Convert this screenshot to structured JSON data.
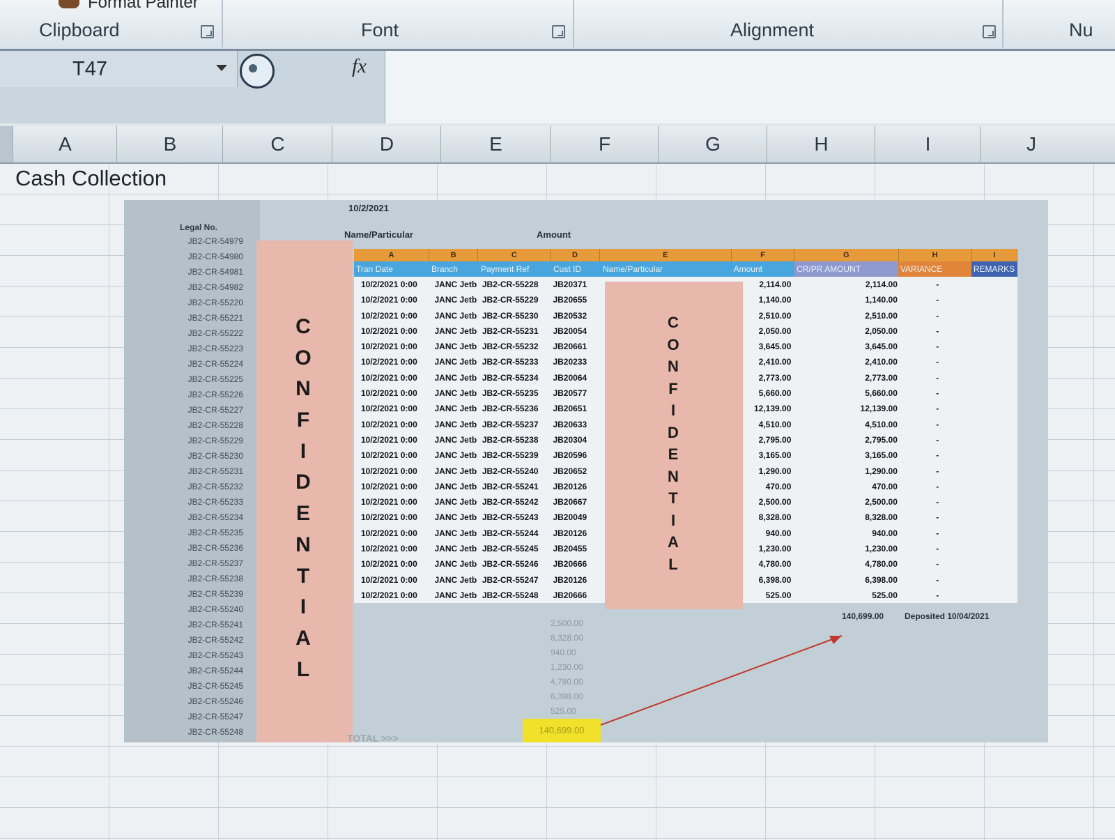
{
  "ribbon": {
    "format_painter": "Format Painter",
    "groups": [
      "Clipboard",
      "Font",
      "Alignment",
      "Nu"
    ]
  },
  "formula_bar": {
    "name_box": "T47",
    "fx_label": "fx",
    "content": ""
  },
  "columns": [
    "A",
    "B",
    "C",
    "D",
    "E",
    "F",
    "G",
    "H",
    "I",
    "J"
  ],
  "sheet": {
    "a1_text": "Cash Collection"
  },
  "pasted_image": {
    "date": "10/2/2021",
    "side_header": "Legal No.",
    "under_headers": {
      "name": "Name/Particular",
      "amount": "Amount"
    },
    "side_items": [
      "JB2-CR-54979",
      "JB2-CR-54980",
      "JB2-CR-54981",
      "JB2-CR-54982",
      "JB2-CR-55220",
      "JB2-CR-55221",
      "JB2-CR-55222",
      "JB2-CR-55223",
      "JB2-CR-55224",
      "JB2-CR-55225",
      "JB2-CR-55226",
      "JB2-CR-55227",
      "JB2-CR-55228",
      "JB2-CR-55229",
      "JB2-CR-55230",
      "JB2-CR-55231",
      "JB2-CR-55232",
      "JB2-CR-55233",
      "JB2-CR-55234",
      "JB2-CR-55235",
      "JB2-CR-55236",
      "JB2-CR-55237",
      "JB2-CR-55238",
      "JB2-CR-55239",
      "JB2-CR-55240",
      "JB2-CR-55241",
      "JB2-CR-55242",
      "JB2-CR-55243",
      "JB2-CR-55244",
      "JB2-CR-55245",
      "JB2-CR-55246",
      "JB2-CR-55247",
      "JB2-CR-55248"
    ],
    "confidential_letters": [
      "C",
      "O",
      "N",
      "F",
      "I",
      "D",
      "E",
      "N",
      "T",
      "I",
      "A",
      "L"
    ],
    "inner_column_letters": [
      "A",
      "B",
      "C",
      "D",
      "E",
      "F",
      "G",
      "H",
      "I"
    ],
    "inner_headers": [
      "Tran Date",
      "Branch",
      "Payment Ref",
      "Cust ID",
      "Name/Particular",
      "Amount",
      "CR/PR AMOUNT",
      "VARIANCE",
      "REMARKS"
    ],
    "rows": [
      {
        "date": "10/2/2021 0:00",
        "branch": "JANC Jetb",
        "ref": "JB2-CR-55228",
        "cust": "JB20371",
        "amount": "2,114.00",
        "cr": "2,114.00",
        "var": "-"
      },
      {
        "date": "10/2/2021 0:00",
        "branch": "JANC Jetb",
        "ref": "JB2-CR-55229",
        "cust": "JB20655",
        "amount": "1,140.00",
        "cr": "1,140.00",
        "var": "-"
      },
      {
        "date": "10/2/2021 0:00",
        "branch": "JANC Jetb",
        "ref": "JB2-CR-55230",
        "cust": "JB20532",
        "amount": "2,510.00",
        "cr": "2,510.00",
        "var": "-"
      },
      {
        "date": "10/2/2021 0:00",
        "branch": "JANC Jetb",
        "ref": "JB2-CR-55231",
        "cust": "JB20054",
        "amount": "2,050.00",
        "cr": "2,050.00",
        "var": "-"
      },
      {
        "date": "10/2/2021 0:00",
        "branch": "JANC Jetb",
        "ref": "JB2-CR-55232",
        "cust": "JB20661",
        "amount": "3,645.00",
        "cr": "3,645.00",
        "var": "-"
      },
      {
        "date": "10/2/2021 0:00",
        "branch": "JANC Jetb",
        "ref": "JB2-CR-55233",
        "cust": "JB20233",
        "amount": "2,410.00",
        "cr": "2,410.00",
        "var": "-"
      },
      {
        "date": "10/2/2021 0:00",
        "branch": "JANC Jetb",
        "ref": "JB2-CR-55234",
        "cust": "JB20064",
        "amount": "2,773.00",
        "cr": "2,773.00",
        "var": "-"
      },
      {
        "date": "10/2/2021 0:00",
        "branch": "JANC Jetb",
        "ref": "JB2-CR-55235",
        "cust": "JB20577",
        "amount": "5,660.00",
        "cr": "5,660.00",
        "var": "-"
      },
      {
        "date": "10/2/2021 0:00",
        "branch": "JANC Jetb",
        "ref": "JB2-CR-55236",
        "cust": "JB20651",
        "amount": "12,139.00",
        "cr": "12,139.00",
        "var": "-"
      },
      {
        "date": "10/2/2021 0:00",
        "branch": "JANC Jetb",
        "ref": "JB2-CR-55237",
        "cust": "JB20633",
        "amount": "4,510.00",
        "cr": "4,510.00",
        "var": "-"
      },
      {
        "date": "10/2/2021 0:00",
        "branch": "JANC Jetb",
        "ref": "JB2-CR-55238",
        "cust": "JB20304",
        "amount": "2,795.00",
        "cr": "2,795.00",
        "var": "-"
      },
      {
        "date": "10/2/2021 0:00",
        "branch": "JANC Jetb",
        "ref": "JB2-CR-55239",
        "cust": "JB20596",
        "amount": "3,165.00",
        "cr": "3,165.00",
        "var": "-"
      },
      {
        "date": "10/2/2021 0:00",
        "branch": "JANC Jetb",
        "ref": "JB2-CR-55240",
        "cust": "JB20652",
        "amount": "1,290.00",
        "cr": "1,290.00",
        "var": "-"
      },
      {
        "date": "10/2/2021 0:00",
        "branch": "JANC Jetb",
        "ref": "JB2-CR-55241",
        "cust": "JB20126",
        "amount": "470.00",
        "cr": "470.00",
        "var": "-"
      },
      {
        "date": "10/2/2021 0:00",
        "branch": "JANC Jetb",
        "ref": "JB2-CR-55242",
        "cust": "JB20667",
        "amount": "2,500.00",
        "cr": "2,500.00",
        "var": "-"
      },
      {
        "date": "10/2/2021 0:00",
        "branch": "JANC Jetb",
        "ref": "JB2-CR-55243",
        "cust": "JB20049",
        "amount": "8,328.00",
        "cr": "8,328.00",
        "var": "-"
      },
      {
        "date": "10/2/2021 0:00",
        "branch": "JANC Jetb",
        "ref": "JB2-CR-55244",
        "cust": "JB20126",
        "amount": "940.00",
        "cr": "940.00",
        "var": "-"
      },
      {
        "date": "10/2/2021 0:00",
        "branch": "JANC Jetb",
        "ref": "JB2-CR-55245",
        "cust": "JB20455",
        "amount": "1,230.00",
        "cr": "1,230.00",
        "var": "-"
      },
      {
        "date": "10/2/2021 0:00",
        "branch": "JANC Jetb",
        "ref": "JB2-CR-55246",
        "cust": "JB20666",
        "amount": "4,780.00",
        "cr": "4,780.00",
        "var": "-"
      },
      {
        "date": "10/2/2021 0:00",
        "branch": "JANC Jetb",
        "ref": "JB2-CR-55247",
        "cust": "JB20126",
        "amount": "6,398.00",
        "cr": "6,398.00",
        "var": "-"
      },
      {
        "date": "10/2/2021 0:00",
        "branch": "JANC Jetb",
        "ref": "JB2-CR-55248",
        "cust": "JB20666",
        "amount": "525.00",
        "cr": "525.00",
        "var": "-"
      }
    ],
    "total_cr": "140,699.00",
    "deposited": "Deposited 10/04/2021",
    "lower_amounts": [
      "2,500.00",
      "8,328.00",
      "940.00",
      "1,230.00",
      "4,780.00",
      "6,398.00",
      "525.00"
    ],
    "highlight_total": "140,699.00",
    "total_label": "TOTAL >>>"
  },
  "colors": {
    "confidential_fill": "#e8b8ad",
    "header_blue": "#49a5dd",
    "header_orange": "#e79a3a",
    "highlight_yellow": "#f1e12a",
    "arrow_red": "#c0392b"
  }
}
